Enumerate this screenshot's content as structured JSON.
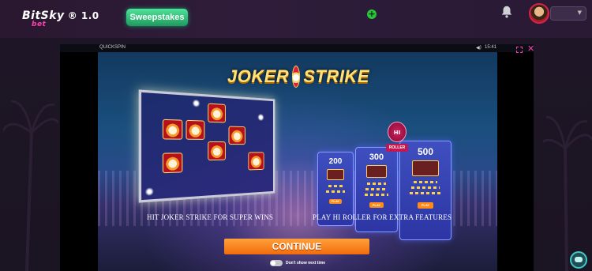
{
  "header": {
    "logo_main": "BitSky",
    "logo_sub": "bet",
    "logo_version": "® 1.0",
    "sweepstakes_label": "Sweepstakes",
    "plus_label": "+",
    "accent_color": "#27c53a"
  },
  "game": {
    "provider": "QUICKSPIN",
    "clock": "15:41",
    "close_label": "✕",
    "title_left": "JOKER",
    "title_right": "STRIKE",
    "bet_cards": [
      {
        "value": "200"
      },
      {
        "value": "300"
      },
      {
        "value": "500"
      }
    ],
    "roller_badge": "HI",
    "roller_label": "ROLLER",
    "card_button": "PLAY",
    "caption_left": "HIT JOKER STRIKE FOR SUPER WINS",
    "caption_right": "PLAY HI ROLLER FOR EXTRA FEATURES",
    "continue_label": "CONTINUE",
    "toggle_label": "Don't show next time",
    "continue_color": "#f26b0c"
  }
}
